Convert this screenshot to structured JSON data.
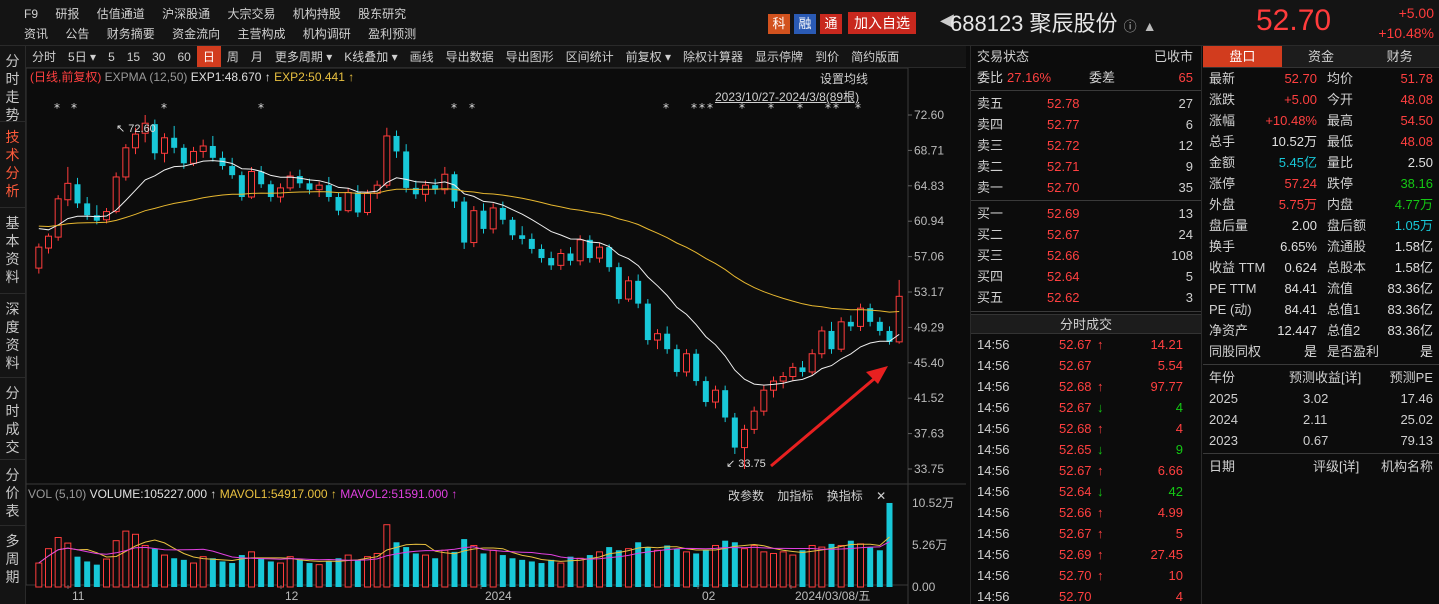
{
  "top": {
    "nav1": [
      "F9",
      "研报",
      "估值通道",
      "沪深股通",
      "大宗交易",
      "机构持股",
      "股东研究"
    ],
    "nav2": [
      "资讯",
      "公告",
      "财务摘要",
      "资金流向",
      "主营构成",
      "机构调研",
      "盈利预测"
    ],
    "badges": [
      "科",
      "融",
      "通"
    ],
    "add_watch": "加入自选",
    "stock_code_name": "688123 聚辰股份",
    "price": "52.70",
    "change": "+5.00",
    "change_pct": "+10.48%"
  },
  "sidebar": [
    "分时走势",
    "技术分析",
    "基本资料",
    "深度资料",
    "分时成交",
    "分价表",
    "多周期"
  ],
  "toolbar": [
    "分时",
    "5日 ▾",
    "5",
    "15",
    "30",
    "60",
    "日",
    "周",
    "月",
    "更多周期 ▾",
    "K线叠加 ▾",
    "画线",
    "导出数据",
    "导出图形",
    "区间统计",
    "前复权 ▾",
    "除权计算器",
    "显示停牌",
    "到价",
    "简约版面"
  ],
  "kline_info": {
    "label": "(日线,前复权)",
    "indicator": "EXPMA (12,50)",
    "exp1": "EXP1:48.670",
    "exp2": "EXP2:50.441",
    "set_ma": "设置均线",
    "range": "2023/10/27-2024/3/8(89根)"
  },
  "vol_info": {
    "label": "VOL (5,10)",
    "volume": "VOLUME:105227.000",
    "mavol1": "MAVOL1:54917.000",
    "mavol2": "MAVOL2:51591.000",
    "tools": [
      "改参数",
      "加指标",
      "换指标",
      "✕"
    ]
  },
  "chart_data": {
    "type": "candlestick",
    "price_axis": [
      "72.60",
      "68.71",
      "64.83",
      "60.94",
      "57.06",
      "53.17",
      "49.29",
      "45.40",
      "41.52",
      "37.63",
      "33.75"
    ],
    "vol_axis": [
      "10.52万",
      "5.26万",
      "0.00"
    ],
    "x_labels": [
      "11",
      "12",
      "2024",
      "02",
      "2024/03/08/五"
    ],
    "annotations": {
      "high": "72.60",
      "low": "33.75"
    },
    "candles": [
      {
        "o": 55.8,
        "h": 58.5,
        "l": 55.2,
        "c": 58.1
      },
      {
        "o": 58.0,
        "h": 59.6,
        "l": 57.4,
        "c": 59.3
      },
      {
        "o": 59.2,
        "h": 63.8,
        "l": 58.8,
        "c": 63.4
      },
      {
        "o": 63.3,
        "h": 66.9,
        "l": 62.6,
        "c": 65.1
      },
      {
        "o": 65.0,
        "h": 65.7,
        "l": 62.4,
        "c": 62.9
      },
      {
        "o": 62.9,
        "h": 63.6,
        "l": 61.1,
        "c": 61.6
      },
      {
        "o": 61.6,
        "h": 62.7,
        "l": 60.6,
        "c": 61.0
      },
      {
        "o": 61.1,
        "h": 62.4,
        "l": 60.7,
        "c": 62.0
      },
      {
        "o": 62.0,
        "h": 66.3,
        "l": 61.8,
        "c": 65.8
      },
      {
        "o": 65.8,
        "h": 69.4,
        "l": 65.4,
        "c": 69.0
      },
      {
        "o": 69.0,
        "h": 71.2,
        "l": 68.3,
        "c": 70.5
      },
      {
        "o": 70.6,
        "h": 72.6,
        "l": 69.6,
        "c": 71.7
      },
      {
        "o": 71.6,
        "h": 72.1,
        "l": 67.7,
        "c": 68.4
      },
      {
        "o": 68.4,
        "h": 70.6,
        "l": 67.4,
        "c": 70.1
      },
      {
        "o": 70.1,
        "h": 71.4,
        "l": 68.4,
        "c": 69.0
      },
      {
        "o": 69.0,
        "h": 69.4,
        "l": 66.7,
        "c": 67.3
      },
      {
        "o": 67.3,
        "h": 69.1,
        "l": 67.0,
        "c": 68.6
      },
      {
        "o": 68.6,
        "h": 69.9,
        "l": 67.9,
        "c": 69.2
      },
      {
        "o": 69.2,
        "h": 70.3,
        "l": 67.5,
        "c": 67.9
      },
      {
        "o": 67.9,
        "h": 68.6,
        "l": 66.6,
        "c": 67.0
      },
      {
        "o": 67.0,
        "h": 67.9,
        "l": 65.6,
        "c": 66.0
      },
      {
        "o": 66.0,
        "h": 66.4,
        "l": 63.2,
        "c": 63.6
      },
      {
        "o": 63.6,
        "h": 66.9,
        "l": 63.4,
        "c": 66.4
      },
      {
        "o": 66.4,
        "h": 67.0,
        "l": 64.6,
        "c": 65.0
      },
      {
        "o": 65.0,
        "h": 65.4,
        "l": 63.1,
        "c": 63.6
      },
      {
        "o": 63.6,
        "h": 65.1,
        "l": 63.0,
        "c": 64.6
      },
      {
        "o": 64.6,
        "h": 66.4,
        "l": 64.3,
        "c": 65.9
      },
      {
        "o": 65.9,
        "h": 66.6,
        "l": 64.6,
        "c": 65.1
      },
      {
        "o": 65.1,
        "h": 65.6,
        "l": 63.9,
        "c": 64.4
      },
      {
        "o": 64.4,
        "h": 65.3,
        "l": 63.6,
        "c": 64.9
      },
      {
        "o": 64.9,
        "h": 65.8,
        "l": 63.1,
        "c": 63.6
      },
      {
        "o": 63.6,
        "h": 64.1,
        "l": 61.6,
        "c": 62.1
      },
      {
        "o": 62.1,
        "h": 64.6,
        "l": 61.9,
        "c": 64.1
      },
      {
        "o": 64.1,
        "h": 64.9,
        "l": 61.4,
        "c": 61.9
      },
      {
        "o": 61.9,
        "h": 64.4,
        "l": 61.6,
        "c": 64.0
      },
      {
        "o": 64.0,
        "h": 65.4,
        "l": 63.4,
        "c": 64.9
      },
      {
        "o": 64.9,
        "h": 71.2,
        "l": 64.6,
        "c": 70.3
      },
      {
        "o": 70.3,
        "h": 70.9,
        "l": 67.9,
        "c": 68.6
      },
      {
        "o": 68.6,
        "h": 69.4,
        "l": 64.1,
        "c": 64.6
      },
      {
        "o": 64.6,
        "h": 65.4,
        "l": 63.4,
        "c": 63.9
      },
      {
        "o": 63.9,
        "h": 65.4,
        "l": 63.1,
        "c": 64.9
      },
      {
        "o": 64.9,
        "h": 65.6,
        "l": 63.9,
        "c": 64.4
      },
      {
        "o": 64.4,
        "h": 66.9,
        "l": 63.9,
        "c": 66.1
      },
      {
        "o": 66.1,
        "h": 66.4,
        "l": 62.4,
        "c": 63.1
      },
      {
        "o": 63.1,
        "h": 63.6,
        "l": 57.9,
        "c": 58.6
      },
      {
        "o": 58.6,
        "h": 62.6,
        "l": 58.1,
        "c": 62.1
      },
      {
        "o": 62.1,
        "h": 62.9,
        "l": 59.6,
        "c": 60.1
      },
      {
        "o": 60.1,
        "h": 62.9,
        "l": 59.6,
        "c": 62.4
      },
      {
        "o": 62.4,
        "h": 63.1,
        "l": 60.6,
        "c": 61.1
      },
      {
        "o": 61.1,
        "h": 61.4,
        "l": 58.9,
        "c": 59.4
      },
      {
        "o": 59.4,
        "h": 60.4,
        "l": 58.4,
        "c": 59.0
      },
      {
        "o": 59.0,
        "h": 59.6,
        "l": 57.4,
        "c": 57.9
      },
      {
        "o": 57.9,
        "h": 58.4,
        "l": 56.4,
        "c": 56.9
      },
      {
        "o": 56.9,
        "h": 57.6,
        "l": 55.6,
        "c": 56.1
      },
      {
        "o": 56.1,
        "h": 57.9,
        "l": 55.6,
        "c": 57.4
      },
      {
        "o": 57.4,
        "h": 58.1,
        "l": 56.1,
        "c": 56.6
      },
      {
        "o": 56.6,
        "h": 59.4,
        "l": 56.1,
        "c": 58.9
      },
      {
        "o": 58.9,
        "h": 59.4,
        "l": 56.4,
        "c": 56.9
      },
      {
        "o": 56.9,
        "h": 58.6,
        "l": 56.4,
        "c": 58.1
      },
      {
        "o": 58.1,
        "h": 58.4,
        "l": 55.4,
        "c": 55.9
      },
      {
        "o": 55.9,
        "h": 56.4,
        "l": 51.9,
        "c": 52.4
      },
      {
        "o": 52.4,
        "h": 54.9,
        "l": 52.1,
        "c": 54.4
      },
      {
        "o": 54.4,
        "h": 55.1,
        "l": 51.4,
        "c": 51.9
      },
      {
        "o": 51.9,
        "h": 52.4,
        "l": 47.4,
        "c": 47.9
      },
      {
        "o": 47.9,
        "h": 49.1,
        "l": 46.9,
        "c": 48.6
      },
      {
        "o": 48.6,
        "h": 49.4,
        "l": 46.4,
        "c": 46.9
      },
      {
        "o": 46.9,
        "h": 47.4,
        "l": 43.9,
        "c": 44.4
      },
      {
        "o": 44.4,
        "h": 46.9,
        "l": 43.9,
        "c": 46.4
      },
      {
        "o": 46.4,
        "h": 46.9,
        "l": 42.9,
        "c": 43.4
      },
      {
        "o": 43.4,
        "h": 43.9,
        "l": 40.6,
        "c": 41.1
      },
      {
        "o": 41.1,
        "h": 42.9,
        "l": 40.4,
        "c": 42.4
      },
      {
        "o": 42.4,
        "h": 42.9,
        "l": 38.9,
        "c": 39.4
      },
      {
        "o": 39.4,
        "h": 39.9,
        "l": 35.4,
        "c": 36.1
      },
      {
        "o": 36.1,
        "h": 38.6,
        "l": 33.75,
        "c": 38.1
      },
      {
        "o": 38.1,
        "h": 40.6,
        "l": 37.6,
        "c": 40.1
      },
      {
        "o": 40.1,
        "h": 42.9,
        "l": 39.6,
        "c": 42.4
      },
      {
        "o": 42.4,
        "h": 43.9,
        "l": 41.6,
        "c": 43.4
      },
      {
        "o": 43.4,
        "h": 44.4,
        "l": 42.6,
        "c": 43.9
      },
      {
        "o": 43.9,
        "h": 45.4,
        "l": 43.4,
        "c": 44.9
      },
      {
        "o": 44.9,
        "h": 45.6,
        "l": 43.9,
        "c": 44.4
      },
      {
        "o": 44.4,
        "h": 46.9,
        "l": 44.1,
        "c": 46.4
      },
      {
        "o": 46.4,
        "h": 49.4,
        "l": 45.9,
        "c": 48.9
      },
      {
        "o": 48.9,
        "h": 49.9,
        "l": 46.4,
        "c": 46.9
      },
      {
        "o": 46.9,
        "h": 50.4,
        "l": 46.6,
        "c": 49.9
      },
      {
        "o": 49.9,
        "h": 50.6,
        "l": 48.9,
        "c": 49.4
      },
      {
        "o": 49.4,
        "h": 51.9,
        "l": 48.9,
        "c": 51.4
      },
      {
        "o": 51.4,
        "h": 51.9,
        "l": 49.4,
        "c": 49.9
      },
      {
        "o": 49.9,
        "h": 50.4,
        "l": 48.4,
        "c": 48.9
      },
      {
        "o": 48.9,
        "h": 49.4,
        "l": 47.4,
        "c": 47.7
      },
      {
        "o": 47.7,
        "h": 54.5,
        "l": 47.5,
        "c": 52.7
      }
    ],
    "volumes": [
      {
        "v": 30000
      },
      {
        "v": 48000
      },
      {
        "v": 62000
      },
      {
        "v": 55000
      },
      {
        "v": 38000
      },
      {
        "v": 32000
      },
      {
        "v": 28000
      },
      {
        "v": 35000
      },
      {
        "v": 58000
      },
      {
        "v": 70000
      },
      {
        "v": 66000
      },
      {
        "v": 52000
      },
      {
        "v": 48000
      },
      {
        "v": 40000
      },
      {
        "v": 36000
      },
      {
        "v": 34000
      },
      {
        "v": 30000
      },
      {
        "v": 38000
      },
      {
        "v": 36000
      },
      {
        "v": 32000
      },
      {
        "v": 30000
      },
      {
        "v": 40000
      },
      {
        "v": 44000
      },
      {
        "v": 36000
      },
      {
        "v": 32000
      },
      {
        "v": 30000
      },
      {
        "v": 38000
      },
      {
        "v": 34000
      },
      {
        "v": 30000
      },
      {
        "v": 28000
      },
      {
        "v": 32000
      },
      {
        "v": 36000
      },
      {
        "v": 40000
      },
      {
        "v": 34000
      },
      {
        "v": 38000
      },
      {
        "v": 42000
      },
      {
        "v": 78000
      },
      {
        "v": 56000
      },
      {
        "v": 50000
      },
      {
        "v": 42000
      },
      {
        "v": 40000
      },
      {
        "v": 36000
      },
      {
        "v": 46000
      },
      {
        "v": 44000
      },
      {
        "v": 60000
      },
      {
        "v": 52000
      },
      {
        "v": 42000
      },
      {
        "v": 46000
      },
      {
        "v": 40000
      },
      {
        "v": 36000
      },
      {
        "v": 34000
      },
      {
        "v": 32000
      },
      {
        "v": 30000
      },
      {
        "v": 34000
      },
      {
        "v": 30000
      },
      {
        "v": 38000
      },
      {
        "v": 36000
      },
      {
        "v": 40000
      },
      {
        "v": 44000
      },
      {
        "v": 50000
      },
      {
        "v": 46000
      },
      {
        "v": 48000
      },
      {
        "v": 56000
      },
      {
        "v": 50000
      },
      {
        "v": 46000
      },
      {
        "v": 52000
      },
      {
        "v": 48000
      },
      {
        "v": 44000
      },
      {
        "v": 42000
      },
      {
        "v": 46000
      },
      {
        "v": 52000
      },
      {
        "v": 58000
      },
      {
        "v": 56000
      },
      {
        "v": 48000
      },
      {
        "v": 52000
      },
      {
        "v": 44000
      },
      {
        "v": 42000
      },
      {
        "v": 44000
      },
      {
        "v": 40000
      },
      {
        "v": 46000
      },
      {
        "v": 52000
      },
      {
        "v": 50000
      },
      {
        "v": 54000
      },
      {
        "v": 52000
      },
      {
        "v": 58000
      },
      {
        "v": 54000
      },
      {
        "v": 50000
      },
      {
        "v": 46000
      },
      {
        "v": 105227
      }
    ],
    "ymin": 33.75,
    "ymax": 72.6,
    "vmax": 105200
  },
  "orderbook": {
    "title": "交易状态",
    "status": "已收市",
    "weibi_k": "委比",
    "weibi_v": "27.16%",
    "weicha_k": "委差",
    "weicha_v": "65",
    "asks": [
      {
        "label": "卖五",
        "price": "52.78",
        "vol": "27"
      },
      {
        "label": "卖四",
        "price": "52.77",
        "vol": "6"
      },
      {
        "label": "卖三",
        "price": "52.72",
        "vol": "12"
      },
      {
        "label": "卖二",
        "price": "52.71",
        "vol": "9"
      },
      {
        "label": "卖一",
        "price": "52.70",
        "vol": "35"
      }
    ],
    "bids": [
      {
        "label": "买一",
        "price": "52.69",
        "vol": "13"
      },
      {
        "label": "买二",
        "price": "52.67",
        "vol": "24"
      },
      {
        "label": "买三",
        "price": "52.66",
        "vol": "108"
      },
      {
        "label": "买四",
        "price": "52.64",
        "vol": "5"
      },
      {
        "label": "买五",
        "price": "52.62",
        "vol": "3"
      }
    ]
  },
  "ticks": {
    "title": "分时成交",
    "rows": [
      {
        "t": "14:56",
        "p": "52.67",
        "d": "up",
        "v": "14.21"
      },
      {
        "t": "14:56",
        "p": "52.67",
        "d": "none",
        "v": "5.54"
      },
      {
        "t": "14:56",
        "p": "52.68",
        "d": "up",
        "v": "97.77"
      },
      {
        "t": "14:56",
        "p": "52.67",
        "d": "down",
        "v": "4"
      },
      {
        "t": "14:56",
        "p": "52.68",
        "d": "up",
        "v": "4"
      },
      {
        "t": "14:56",
        "p": "52.65",
        "d": "down",
        "v": "9"
      },
      {
        "t": "14:56",
        "p": "52.67",
        "d": "up",
        "v": "6.66"
      },
      {
        "t": "14:56",
        "p": "52.64",
        "d": "down",
        "v": "42"
      },
      {
        "t": "14:56",
        "p": "52.66",
        "d": "up",
        "v": "4.99"
      },
      {
        "t": "14:56",
        "p": "52.67",
        "d": "up",
        "v": "5"
      },
      {
        "t": "14:56",
        "p": "52.69",
        "d": "up",
        "v": "27.45"
      },
      {
        "t": "14:56",
        "p": "52.70",
        "d": "up",
        "v": "10"
      },
      {
        "t": "14:56",
        "p": "52.70",
        "d": "none",
        "v": "4"
      }
    ]
  },
  "quote": {
    "tabs": [
      "盘口",
      "资金",
      "财务"
    ],
    "rows": [
      {
        "k1": "最新",
        "v1": "52.70",
        "c1": "red",
        "k2": "均价",
        "v2": "51.78",
        "c2": "red"
      },
      {
        "k1": "涨跌",
        "v1": "+5.00",
        "c1": "red",
        "k2": "今开",
        "v2": "48.08",
        "c2": "red"
      },
      {
        "k1": "涨幅",
        "v1": "+10.48%",
        "c1": "red",
        "k2": "最高",
        "v2": "54.50",
        "c2": "red"
      },
      {
        "k1": "总手",
        "v1": "10.52万",
        "c1": "white",
        "k2": "最低",
        "v2": "48.08",
        "c2": "red"
      },
      {
        "k1": "金额",
        "v1": "5.45亿",
        "c1": "cyan",
        "k2": "量比",
        "v2": "2.50",
        "c2": "white"
      },
      {
        "k1": "涨停",
        "v1": "57.24",
        "c1": "red",
        "k2": "跌停",
        "v2": "38.16",
        "c2": "green"
      },
      {
        "k1": "外盘",
        "v1": "5.75万",
        "c1": "red",
        "k2": "内盘",
        "v2": "4.77万",
        "c2": "green"
      },
      {
        "k1": "盘后量",
        "v1": "2.00",
        "c1": "white",
        "k2": "盘后额",
        "v2": "1.05万",
        "c2": "cyan"
      },
      {
        "k1": "换手",
        "v1": "6.65%",
        "c1": "white",
        "k2": "流通股",
        "v2": "1.58亿",
        "c2": "white"
      },
      {
        "k1": "收益 TTM",
        "v1": "0.624",
        "c1": "white",
        "k2": "总股本",
        "v2": "1.58亿",
        "c2": "white"
      },
      {
        "k1": "PE TTM",
        "v1": "84.41",
        "c1": "white",
        "k2": "流值",
        "v2": "83.36亿",
        "c2": "white"
      },
      {
        "k1": "PE (动)",
        "v1": "84.41",
        "c1": "white",
        "k2": "总值1",
        "v2": "83.36亿",
        "c2": "white"
      },
      {
        "k1": "净资产",
        "v1": "12.447",
        "c1": "white",
        "k2": "总值2",
        "v2": "83.36亿",
        "c2": "white"
      },
      {
        "k1": "同股同权",
        "v1": "是",
        "c1": "white",
        "k2": "是否盈利",
        "v2": "是",
        "c2": "white"
      }
    ],
    "forecast_head": [
      "年份",
      "预测收益[详]",
      "预测PE"
    ],
    "forecast": [
      {
        "y": "2025",
        "e": "3.02",
        "pe": "17.46"
      },
      {
        "y": "2024",
        "e": "2.11",
        "pe": "25.02"
      },
      {
        "y": "2023",
        "e": "0.67",
        "pe": "79.13"
      }
    ],
    "rating_head": [
      "日期",
      "评级[详]",
      "机构名称"
    ]
  }
}
